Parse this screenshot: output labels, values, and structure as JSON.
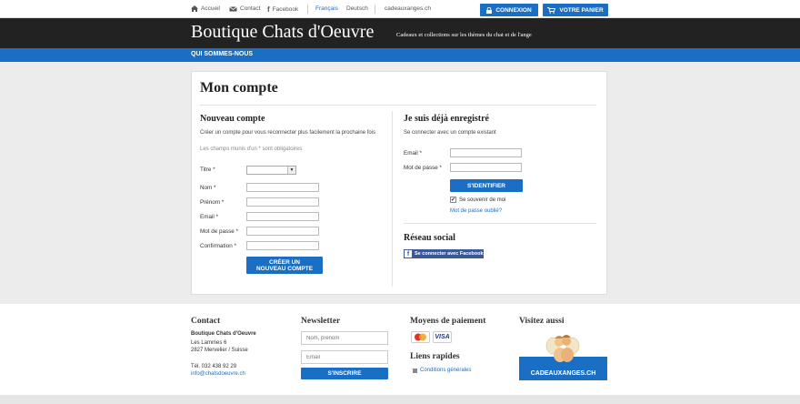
{
  "topbar": {
    "home_label": "Accueil",
    "contact_label": "Contact",
    "facebook_label": "Facebook",
    "lang_fr": "Français",
    "lang_de": "Deutsch",
    "external_site": "cadeauxanges.ch",
    "login_button": "CONNEXION",
    "cart_button": "VOTRE PANIER"
  },
  "header": {
    "brand": "Boutique Chats d'Oeuvre",
    "tagline": "Cadeaux et collections sur les thèmes du chat et de l'ange"
  },
  "nav": {
    "item_about": "QUI SOMMES-NOUS"
  },
  "page": {
    "title": "Mon compte"
  },
  "register": {
    "heading": "Nouveau compte",
    "intro": "Créer un compte pour vous reconnecter plus facilement la prochaine fois",
    "required_note": "Les champs munis d'un * sont obligatoires",
    "title_label": "Titre *",
    "title_value": "",
    "lastname_label": "Nom *",
    "firstname_label": "Prénom *",
    "email_label": "Email *",
    "password_label": "Mot de passe *",
    "confirm_label": "Confirmation *",
    "submit": "CRÉER UN NOUVEAU COMPTE"
  },
  "login": {
    "heading": "Je suis déjà enregistré",
    "intro": "Se connecter avec un compte existant",
    "email_label": "Email *",
    "password_label": "Mot de passe *",
    "submit": "S'IDENTIFIER",
    "remember_label": "Se souvenir de moi",
    "remember_checked": true,
    "forgot_link": "Mot de passe oublié?"
  },
  "social": {
    "heading": "Réseau social",
    "facebook_button": "Se connecter avec Facebook"
  },
  "footer": {
    "contact": {
      "heading": "Contact",
      "company": "Boutique Chats d'Oeuvre",
      "street": "Les Lammes 6",
      "city": "2827 Mervelier / Suisse",
      "phone": "Tél. 032 438 92 29",
      "email": "info@chatsdoeuvre.ch"
    },
    "newsletter": {
      "heading": "Newsletter",
      "name_placeholder": "Nom, prénom",
      "email_placeholder": "Email",
      "submit": "S'INSCRIRE"
    },
    "payment": {
      "heading": "Moyens de paiement",
      "visa_label": "VISA"
    },
    "quicklinks": {
      "heading": "Liens rapides",
      "terms": "Conditions générales"
    },
    "visit": {
      "heading": "Visitez aussi",
      "button": "CADEAUXANGES.CH"
    }
  },
  "colors": {
    "accent_blue": "#1a6fc4",
    "header_dark": "#222222",
    "facebook_blue": "#3b5998"
  }
}
